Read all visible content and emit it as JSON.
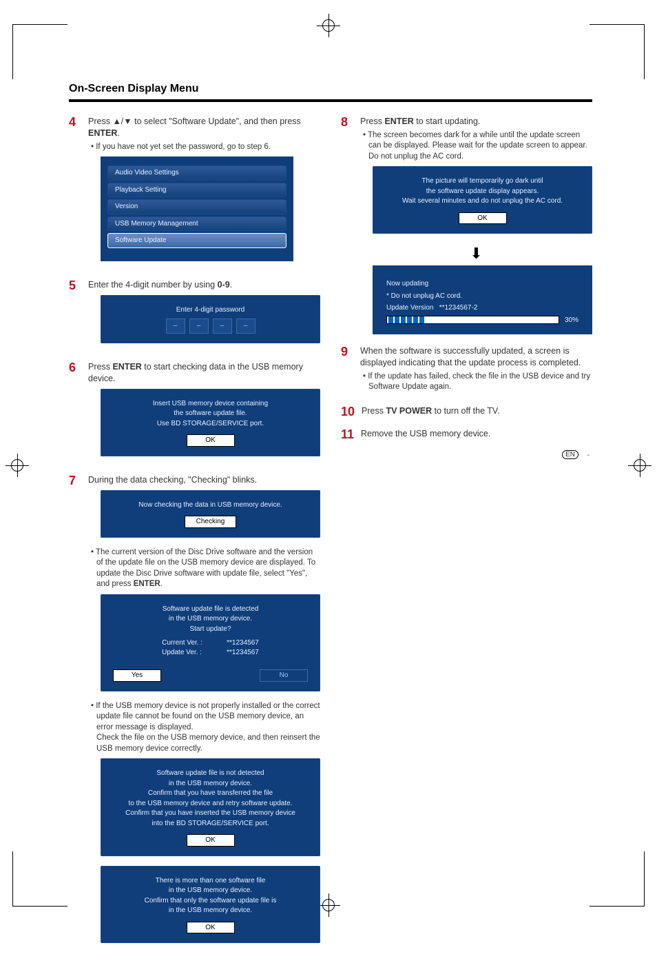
{
  "section_title": "On-Screen Display Menu",
  "step4": {
    "lead_a": "Press ",
    "arrows": "▲/▼",
    "lead_b": " to select \"Software Update\", and then press ",
    "enter": "ENTER",
    "lead_c": ".",
    "sub": "If you have not yet set the password, go to step 6.",
    "menu": {
      "items": [
        "Audio Video Settings",
        "Playback Setting",
        "Version",
        "USB Memory Management",
        "Software Update"
      ],
      "selected_index": 4
    }
  },
  "step5": {
    "lead": "Enter the 4-digit number by using ",
    "keys": "0-9",
    "tail": ".",
    "dialog_title": "Enter 4-digit password",
    "placeholder": "–"
  },
  "step6": {
    "lead_a": "Press ",
    "enter": "ENTER",
    "lead_b": " to start checking data in the USB memory device.",
    "dlg": {
      "l1": "Insert USB memory device containing",
      "l2": "the software update file.",
      "l3": "Use BD STORAGE/SERVICE port.",
      "ok": "OK"
    }
  },
  "step7": {
    "lead": "During the data checking, \"Checking\" blinks.",
    "dlg_a": {
      "l1": "Now checking the data in USB memory device.",
      "btn": "Checking"
    },
    "sub_a": "The current version of the Disc Drive software and the version of the update file on the USB memory device are displayed. To update the Disc Drive software with update file, select \"Yes\", and press ",
    "sub_a_enter": "ENTER",
    "sub_a_tail": ".",
    "dlg_b": {
      "l1": "Software update file is detected",
      "l2": "in the USB memory device.",
      "l3": "Start update?",
      "current_k": "Current Ver. :",
      "current_v": "**1234567",
      "update_k": "Update Ver. :",
      "update_v": "**1234567",
      "yes": "Yes",
      "no": "No"
    },
    "sub_b": "If the USB memory device is not properly installed or the correct update file cannot be found on the USB memory device, an error message is displayed.\nCheck the file on the USB memory device, and then reinsert the USB memory device correctly.",
    "dlg_c": {
      "l1": "Software update file is not detected",
      "l2": "in the USB memory device.",
      "l3": "Confirm that you have transferred the file",
      "l4": "to the USB memory device and retry software update.",
      "l5": "Confirm that you have inserted the USB memory device",
      "l6": "into the BD STORAGE/SERVICE port.",
      "ok": "OK"
    },
    "dlg_d": {
      "l1": "There is more than one software file",
      "l2": "in the USB memory device.",
      "l3": "Confirm that only the software update file is",
      "l4": "in the USB memory device.",
      "ok": "OK"
    }
  },
  "step8": {
    "lead_a": "Press ",
    "enter": "ENTER",
    "lead_b": " to start updating.",
    "sub": "The screen becomes dark for a while until the update screen can be displayed. Please wait for the update screen to appear. Do not unplug the AC cord.",
    "dlg_top": {
      "l1": "The picture will temporarily go dark until",
      "l2": "the software update display appears.",
      "l3": "Wait several minutes and do not unplug the AC cord.",
      "ok": "OK"
    },
    "arrow": "⬇",
    "dlg_upd": {
      "title": "Now updating",
      "warn": "* Do not unplug AC cord.",
      "ver_k": "Update Version",
      "ver_v": "**1234567-2",
      "pct": "30%"
    }
  },
  "step9": {
    "lead": "When the software is successfully updated, a screen is displayed indicating that the update process is completed.",
    "sub": "If the update has failed, check the file in the USB device and try Software Update again."
  },
  "step10": {
    "lead_a": "Press ",
    "key": "TV POWER",
    "lead_b": " to turn off the TV."
  },
  "step11": {
    "lead": "Remove the USB memory device."
  },
  "footer": {
    "en": "EN",
    "dash": "-"
  }
}
